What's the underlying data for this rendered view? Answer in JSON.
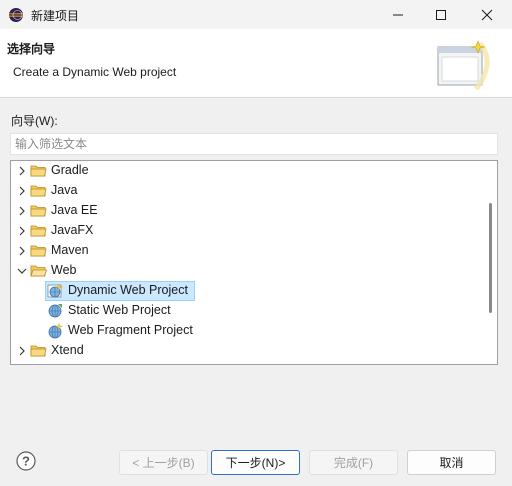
{
  "window": {
    "title": "新建项目",
    "icon": "eclipse-icon"
  },
  "banner": {
    "title": "选择向导",
    "description": "Create a Dynamic Web project",
    "graphic_icon": "wizard-banner-icon"
  },
  "wizards": {
    "label": "向导(W):",
    "filter_placeholder": "输入筛选文本",
    "filter_value": ""
  },
  "tree": {
    "items": [
      {
        "label": "Gradle",
        "type": "folder",
        "expanded": false,
        "level": 0
      },
      {
        "label": "Java",
        "type": "folder",
        "expanded": false,
        "level": 0
      },
      {
        "label": "Java EE",
        "type": "folder",
        "expanded": false,
        "level": 0
      },
      {
        "label": "JavaFX",
        "type": "folder",
        "expanded": false,
        "level": 0
      },
      {
        "label": "Maven",
        "type": "folder",
        "expanded": false,
        "level": 0
      },
      {
        "label": "Web",
        "type": "folder",
        "expanded": true,
        "level": 0
      },
      {
        "label": "Dynamic Web Project",
        "type": "project",
        "selected": true,
        "level": 1
      },
      {
        "label": "Static Web Project",
        "type": "project",
        "level": 1
      },
      {
        "label": "Web Fragment Project",
        "type": "project",
        "level": 1
      },
      {
        "label": "Xtend",
        "type": "folder",
        "expanded": false,
        "level": 0
      }
    ]
  },
  "buttons": {
    "back": "< 上一步(B)",
    "next": "下一步(N)>",
    "finish": "完成(F)",
    "cancel": "取消"
  },
  "colors": {
    "selection": "#cce8ff",
    "folder": "#e8b84a",
    "primary_border": "#2f6fd1"
  }
}
